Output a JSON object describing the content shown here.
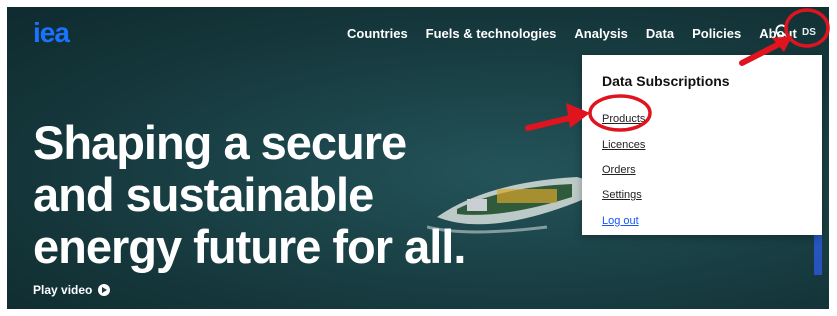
{
  "nav": {
    "logo": "iea",
    "items": [
      "Countries",
      "Fuels & technologies",
      "Analysis",
      "Data",
      "Policies",
      "About"
    ],
    "user_initials": "DS"
  },
  "hero": {
    "line1": "Shaping a secure",
    "line2": "and sustainable",
    "line3": "energy future for all.",
    "play_label": "Play video"
  },
  "dropdown": {
    "title": "Data Subscriptions",
    "items": [
      "Products",
      "Licences",
      "Orders",
      "Settings",
      "Log out"
    ]
  },
  "colors": {
    "accent": "#1a73ff",
    "annotation": "#e0141e",
    "hero_bg": "#1b4449"
  }
}
